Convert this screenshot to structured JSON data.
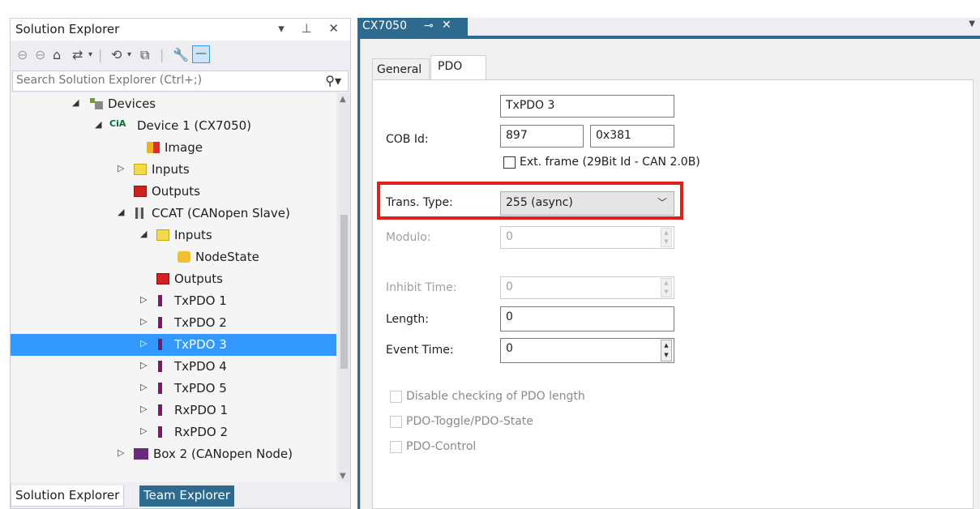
{
  "solution_explorer": {
    "title": "Solution Explorer",
    "title_controls": "▾ ⊥ ✕",
    "search_placeholder": "Search Solution Explorer (Ctrl+;)",
    "tree": [
      {
        "label": "Devices",
        "icon": "devices-icon"
      },
      {
        "label": "Device 1 (CX7050)",
        "icon": "cia-icon",
        "prefix": "CiA"
      },
      {
        "label": "Image",
        "icon": "image-icon"
      },
      {
        "label": "Inputs",
        "icon": "inputs-folder-icon"
      },
      {
        "label": "Outputs",
        "icon": "outputs-folder-icon"
      },
      {
        "label": "CCAT (CANopen Slave)",
        "icon": "ccat-icon"
      },
      {
        "label": "Inputs",
        "icon": "inputs-folder-icon"
      },
      {
        "label": "NodeState",
        "icon": "variable-icon"
      },
      {
        "label": "Outputs",
        "icon": "outputs-folder-icon"
      },
      {
        "label": "TxPDO 1",
        "icon": "txpdo-icon"
      },
      {
        "label": "TxPDO 2",
        "icon": "txpdo-icon"
      },
      {
        "label": "TxPDO 3",
        "icon": "txpdo-icon",
        "selected": true
      },
      {
        "label": "TxPDO 4",
        "icon": "txpdo-icon"
      },
      {
        "label": "TxPDO 5",
        "icon": "txpdo-icon"
      },
      {
        "label": "RxPDO 1",
        "icon": "rxpdo-icon"
      },
      {
        "label": "RxPDO 2",
        "icon": "rxpdo-icon"
      },
      {
        "label": "Box 2 (CANopen Node)",
        "icon": "box-icon"
      }
    ],
    "bottom_tabs": [
      "Solution Explorer",
      "Team Explorer"
    ]
  },
  "document": {
    "tab_label": "CX7050",
    "tabs": [
      "General",
      "PDO"
    ],
    "active_tab": "PDO",
    "pdo": {
      "name": "TxPDO 3",
      "cob_id_label": "COB Id:",
      "cob_id_dec": "897",
      "cob_id_hex": "0x381",
      "ext_frame_label": "Ext. frame (29Bit Id - CAN 2.0B)",
      "trans_type_label": "Trans. Type:",
      "trans_type_value": "255 (async)",
      "modulo_label": "Modulo:",
      "modulo_value": "0",
      "inhibit_label": "Inhibit Time:",
      "inhibit_value": "0",
      "length_label": "Length:",
      "length_value": "0",
      "event_label": "Event Time:",
      "event_value": "0",
      "checkboxes": [
        "Disable checking of PDO length",
        "PDO-Toggle/PDO-State",
        "PDO-Control"
      ]
    }
  },
  "colors": {
    "selection": "#3399ff",
    "tab_active": "#2d6a8e",
    "highlight": "#e02020"
  }
}
